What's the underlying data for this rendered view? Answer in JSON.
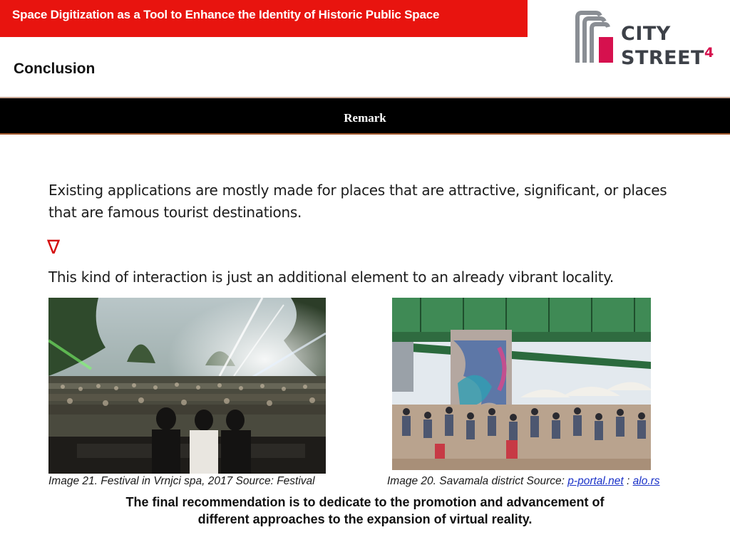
{
  "header": {
    "title": "Space Digitization as a Tool to Enhance the Identity of Historic Public Space",
    "section": "Conclusion"
  },
  "logo": {
    "line1": "CITY",
    "line2": "STREET",
    "superscript": "4",
    "colors": {
      "gray": "#3d4148",
      "accent": "#d6114e"
    }
  },
  "remark_bar": {
    "label": "Remark"
  },
  "content": {
    "paragraph_1": "Existing applications are mostly made for places that are attractive, significant, or places that are famous tourist destinations.",
    "arrow_icon": "down-triangle-outline-icon",
    "paragraph_2": "This kind of interaction is just an additional element to an already vibrant locality."
  },
  "images": [
    {
      "caption": "Image 21. Festival in Vrnjci spa, 2017 Source: Festival"
    },
    {
      "caption_prefix": "Image 20. Savamala district Source: ",
      "link_1": "p-portal.net",
      "separator": " : ",
      "link_2": "alo.rs"
    }
  ],
  "recommendation": {
    "line_1": "The final recommendation is to dedicate to the promotion and advancement of",
    "line_2": "different approaches to the expansion of virtual reality."
  },
  "colors": {
    "title_bar": "#e8140f",
    "remark_bar": "#000000",
    "arrow": "#d40c0c",
    "link": "#1a32c8"
  }
}
